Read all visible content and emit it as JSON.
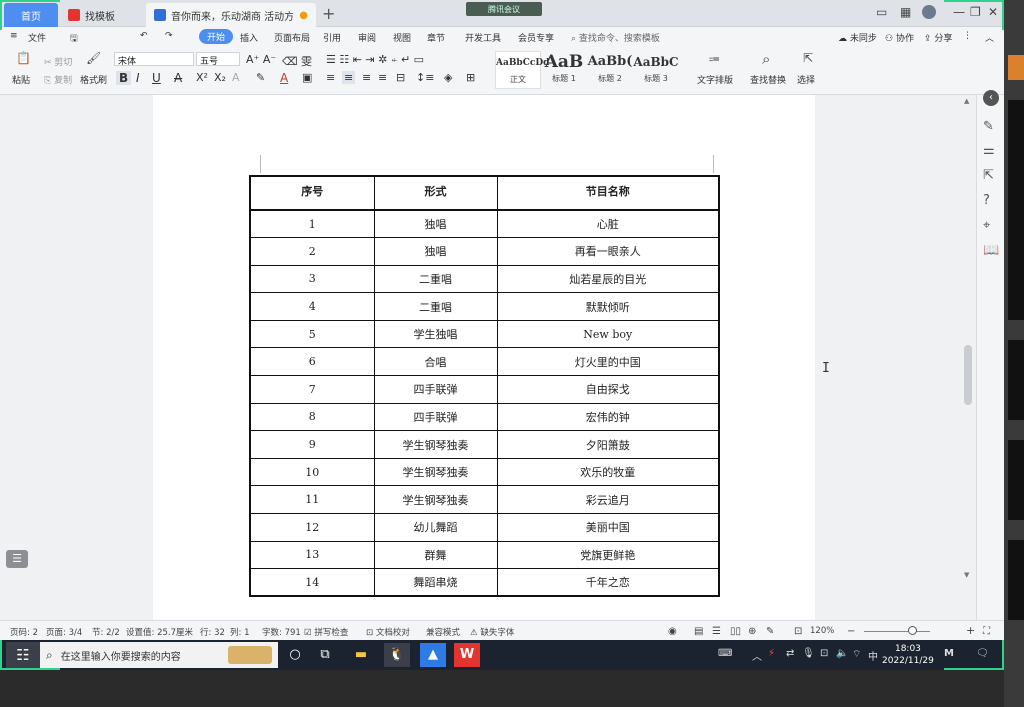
{
  "tabs": {
    "home": "首页",
    "template": "找模板",
    "document": "音你而来，乐动湖商 活动方案"
  },
  "meeting": "腾讯会议",
  "menu": {
    "file": "文件",
    "items": [
      "开始",
      "插入",
      "页面布局",
      "引用",
      "审阅",
      "视图",
      "章节",
      "开发工具",
      "会员专享"
    ],
    "search": "查找命令、搜索模板",
    "sync": "未同步",
    "collab": "协作",
    "share": "分享"
  },
  "ribbon": {
    "paste": "粘贴",
    "cut": "剪切",
    "copy": "复制",
    "format_painter": "格式刷",
    "font_name": "宋体",
    "font_size": "五号",
    "styles": [
      {
        "sample": "AaBbCcDd",
        "label": "正文"
      },
      {
        "sample": "AaB",
        "label": "标题 1"
      },
      {
        "sample": "AaBb(",
        "label": "标题 2"
      },
      {
        "sample": "AaBbC",
        "label": "标题 3"
      }
    ],
    "text_layout": "文字排版",
    "find_replace": "查找替换",
    "select": "选择"
  },
  "table": {
    "headers": [
      "序号",
      "形式",
      "节目名称"
    ],
    "rows": [
      [
        "1",
        "独唱",
        "心脏"
      ],
      [
        "2",
        "独唱",
        "再看一眼亲人"
      ],
      [
        "3",
        "二重唱",
        "灿若星辰的目光"
      ],
      [
        "4",
        "二重唱",
        "默默倾听"
      ],
      [
        "5",
        "学生独唱",
        "New boy"
      ],
      [
        "6",
        "合唱",
        "灯火里的中国"
      ],
      [
        "7",
        "四手联弹",
        "自由探戈"
      ],
      [
        "8",
        "四手联弹",
        "宏伟的钟"
      ],
      [
        "9",
        "学生钢琴独奏",
        "夕阳箫鼓"
      ],
      [
        "10",
        "学生钢琴独奏",
        "欢乐的牧童"
      ],
      [
        "11",
        "学生钢琴独奏",
        "彩云追月"
      ],
      [
        "12",
        "幼儿舞蹈",
        "美丽中国"
      ],
      [
        "13",
        "群舞",
        "党旗更鲜艳"
      ],
      [
        "14",
        "舞蹈串烧",
        "千年之恋"
      ]
    ]
  },
  "status": {
    "page_no": "页码: 2",
    "pages": "页面: 3/4",
    "section": "节: 2/2",
    "setting": "设置值: 25.7厘米",
    "row": "行: 32",
    "col": "列: 1",
    "words": "字数: 791",
    "spell": "拼写检查",
    "proof": "文档校对",
    "compat": "兼容模式",
    "missing_font": "缺失字体",
    "zoom": "120%"
  },
  "taskbar": {
    "search_placeholder": "在这里输入你要搜索的内容",
    "time": "18:03",
    "date": "2022/11/29",
    "ime": "中"
  }
}
